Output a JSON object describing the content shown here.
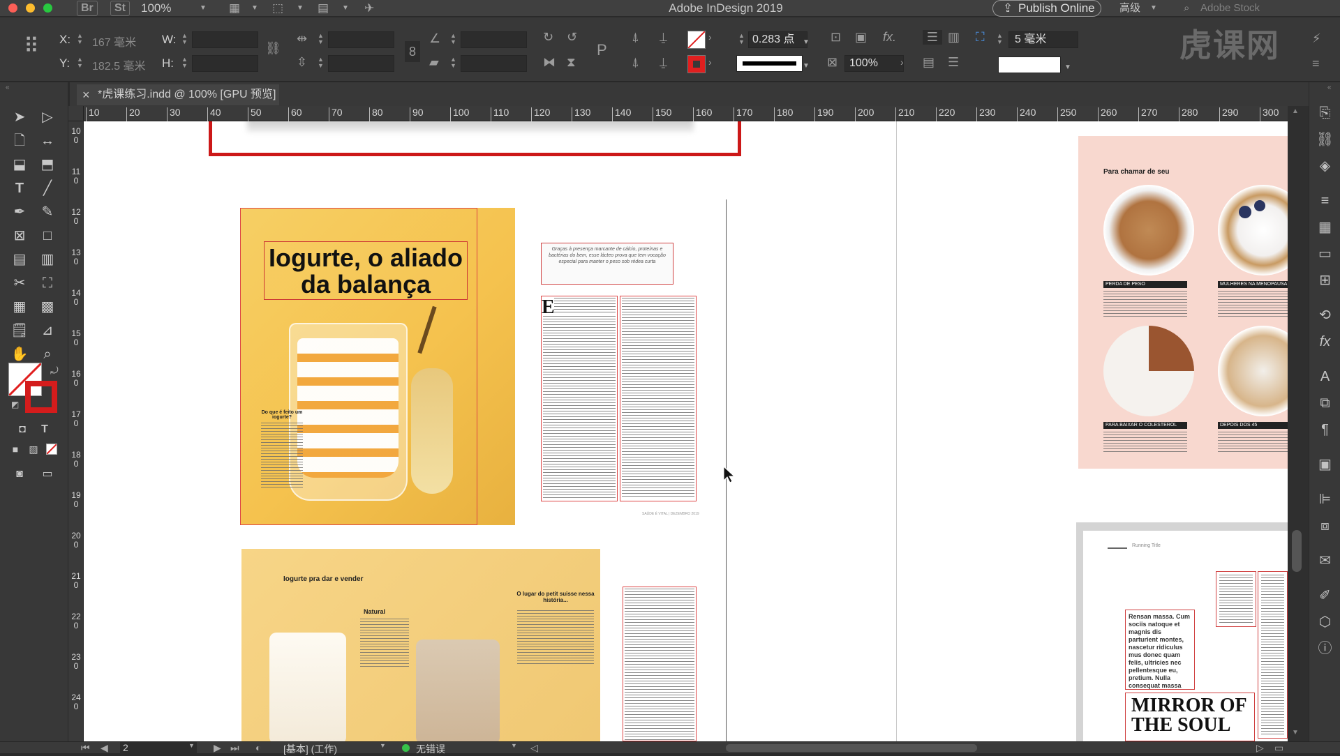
{
  "window": {
    "title": "Adobe InDesign 2019",
    "apps": [
      "Br",
      "St"
    ],
    "zoom": "100%",
    "publish_label": "Publish Online",
    "workspace": "高级",
    "search_placeholder": "Adobe Stock",
    "watermark": "虎课网"
  },
  "control": {
    "x_label": "X:",
    "x_value": "167 毫米",
    "y_label": "Y:",
    "y_value": "182.5 毫米",
    "w_label": "W:",
    "h_label": "H:",
    "stroke_weight": "0.283 点",
    "opacity": "100%",
    "gap": "5 毫米"
  },
  "tab": {
    "close": "×",
    "label": "*虎课练习.indd @ 100% [GPU 预览]"
  },
  "ruler": {
    "h_ticks": [
      "10",
      "20",
      "30",
      "40",
      "50",
      "60",
      "70",
      "80",
      "90",
      "100",
      "110",
      "120",
      "130",
      "140",
      "150",
      "160",
      "170",
      "180",
      "190",
      "200",
      "210",
      "220",
      "230",
      "240",
      "250",
      "260",
      "270",
      "280",
      "290",
      "300"
    ],
    "v_ticks": [
      "100",
      "110",
      "120",
      "130",
      "140",
      "150",
      "160",
      "170",
      "180",
      "190",
      "200",
      "210",
      "220",
      "230",
      "240"
    ]
  },
  "page": {
    "yogurt_title": "Iogurte, o aliado da balança",
    "yogurt_sidebar_heading": "Do que é feito um iogurte?",
    "deck": "Graças à presença marcante de cálcio, proteínas e bactérias do bem, esse lácteo prova que tem vocação especial para manter o peso sob rédea curta",
    "drop_cap": "E",
    "folio": "SAÚDE É VITAL | DEZEMBRO 2019",
    "smoothie_heading": "Iogurte pra dar e vender",
    "smoothie_label_natural": "Natural",
    "smoothie_label_petit": "O lugar do petit suisse nessa história...",
    "right_heading": "Para chamar de seu",
    "right_labels": [
      "PERDA DE PESO",
      "MULHERES NA MENOPAUSA",
      "PARA BAIXAR O COLESTEROL",
      "DEPOIS DOS 45"
    ],
    "running_title": "Running Title",
    "master_text": "Rensan massa. Cum sociis natoque et magnis dis parturient montes, nascetur ridiculus mus donec quam felis, ultricies nec pellentesque eu, pretium. Nulla consequat massa quis enimonec pede",
    "mirror_title": "MIRROR OF THE SOUL"
  },
  "status": {
    "page_number": "2",
    "preflight_profile": "[基本] (工作)",
    "errors": "无错误"
  }
}
